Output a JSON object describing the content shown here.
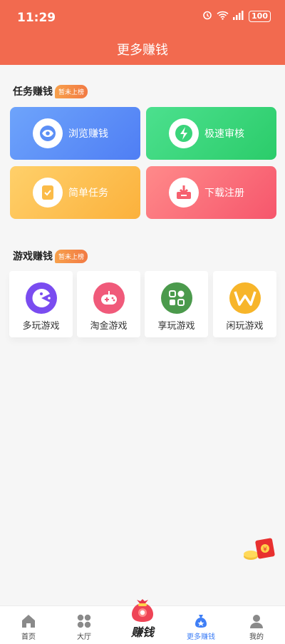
{
  "status": {
    "time": "11:29",
    "battery": "100"
  },
  "header": {
    "title": "更多赚钱"
  },
  "tasks_section": {
    "title": "任务赚钱",
    "badge": "暂未上榜",
    "items": [
      {
        "label": "浏览赚钱",
        "icon": "eye-icon"
      },
      {
        "label": "极速审核",
        "icon": "lightning-icon"
      },
      {
        "label": "简单任务",
        "icon": "document-check-icon"
      },
      {
        "label": "下载注册",
        "icon": "download-icon"
      }
    ]
  },
  "games_section": {
    "title": "游戏赚钱",
    "badge": "暂未上榜",
    "items": [
      {
        "label": "多玩游戏",
        "icon": "pacman-icon",
        "color": "#7a4cf0"
      },
      {
        "label": "淘金游戏",
        "icon": "gamepad-icon",
        "color": "#f05a7a"
      },
      {
        "label": "享玩游戏",
        "icon": "grid-apps-icon",
        "color": "#4b9a4c"
      },
      {
        "label": "闲玩游戏",
        "icon": "w-logo-icon",
        "color": "#f7b52a"
      }
    ]
  },
  "tabbar": {
    "items": [
      {
        "label": "首页",
        "icon": "home-icon"
      },
      {
        "label": "大厅",
        "icon": "grid-icon"
      },
      {
        "label": "赚钱",
        "icon": "money-bag-icon"
      },
      {
        "label": "更多赚钱",
        "icon": "money-bag-small-icon",
        "active": true
      },
      {
        "label": "我的",
        "icon": "user-icon"
      }
    ]
  },
  "colors": {
    "header": "#f26a4f",
    "active_tab": "#3f7ff6"
  }
}
